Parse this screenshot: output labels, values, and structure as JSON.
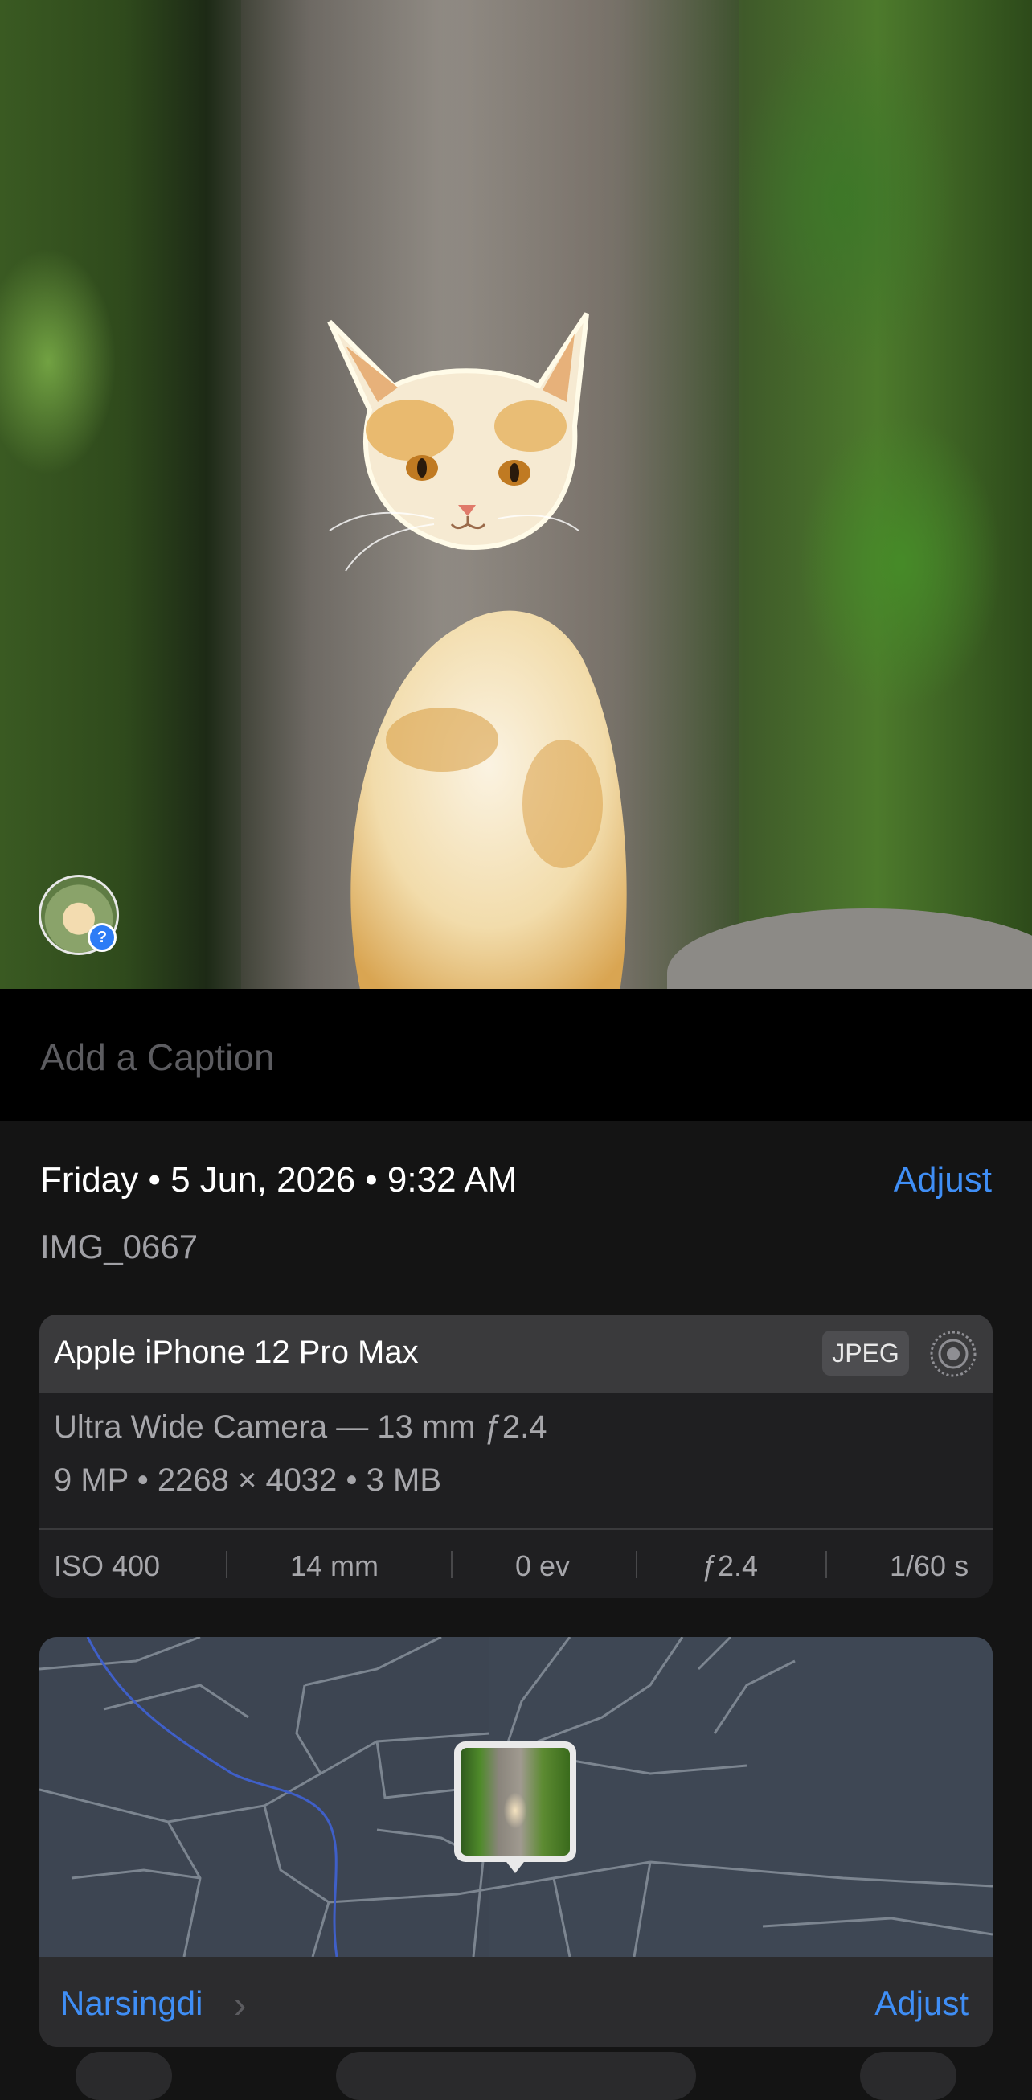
{
  "photo": {
    "subject_icon": "cat-photo",
    "people_badge_icon": "question-mark-icon",
    "people_badge_glyph": "?"
  },
  "caption": {
    "placeholder": "Add a Caption"
  },
  "info": {
    "date": "Friday • 5 Jun, 2026 • 9:32 AM",
    "adjust_label": "Adjust",
    "filename": "IMG_0667"
  },
  "device": {
    "name": "Apple iPhone 12 Pro Max",
    "format": "JPEG",
    "live_icon": "live-photo-icon",
    "lens": "Ultra Wide Camera — 13 mm ƒ2.4",
    "specs": "9 MP • 2268 × 4032 • 3 MB",
    "exif": {
      "iso": "ISO 400",
      "focal": "14 mm",
      "ev": "0 ev",
      "aperture": "ƒ2.4",
      "shutter": "1/60 s"
    }
  },
  "map": {
    "place": "Narsingdi",
    "chevron": "›",
    "adjust_label": "Adjust"
  },
  "colors": {
    "accent": "#3f8ef5",
    "background": "#141414",
    "card": "#1f1f21",
    "card_header": "#3a3a3c"
  }
}
